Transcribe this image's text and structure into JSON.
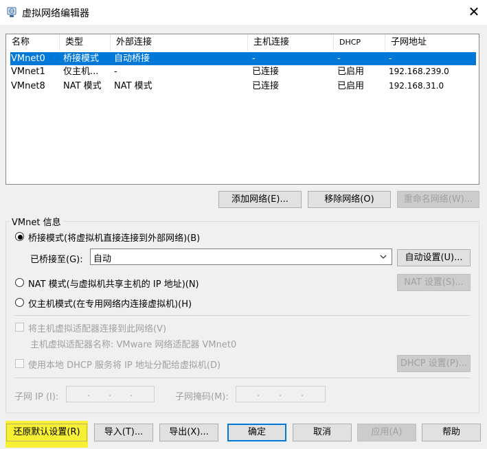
{
  "window": {
    "title": "虚拟网络编辑器",
    "close_label": "✕"
  },
  "table": {
    "columns": [
      "名称",
      "类型",
      "外部连接",
      "主机连接",
      "DHCP",
      "子网地址"
    ],
    "rows": [
      {
        "name": "VMnet0",
        "type": "桥接模式",
        "external": "自动桥接",
        "host": "-",
        "dhcp": "-",
        "subnet": "-"
      },
      {
        "name": "VMnet1",
        "type": "仅主机...",
        "external": "-",
        "host": "已连接",
        "dhcp": "已启用",
        "subnet": "192.168.239.0"
      },
      {
        "name": "VMnet8",
        "type": "NAT 模式",
        "external": "NAT 模式",
        "host": "已连接",
        "dhcp": "已启用",
        "subnet": "192.168.31.0"
      }
    ],
    "selected_row": 0
  },
  "net_buttons": {
    "add": "添加网络(E)...",
    "remove": "移除网络(O)",
    "rename": "重命名网络(W)..."
  },
  "vmnet_info": {
    "group_title": "VMnet 信息",
    "bridge_radio": "桥接模式(将虚拟机直接连接到外部网络)(B)",
    "bridged_to_label": "已桥接至(G):",
    "bridged_to_value": "自动",
    "auto_settings": "自动设置(U)...",
    "nat_radio": "NAT 模式(与虚拟机共享主机的 IP 地址)(N)",
    "nat_settings": "NAT 设置(S)...",
    "hostonly_radio": "仅主机模式(在专用网络内连接虚拟机)(H)",
    "connect_adapter": "将主机虚拟适配器连接到此网络(V)",
    "adapter_name": "主机虚拟适配器名称: VMware 网络适配器 VMnet0",
    "use_dhcp": "使用本地 DHCP 服务将 IP 地址分配给虚拟机(D)",
    "dhcp_settings": "DHCP 设置(P)...",
    "subnet_ip_label": "子网 IP (I):",
    "subnet_mask_label": "子网掩码(M):",
    "ip_dots": ".",
    "selected_mode": "bridge"
  },
  "footer": {
    "restore": "还原默认设置(R)",
    "import": "导入(T)...",
    "export": "导出(X)...",
    "ok": "确定",
    "cancel": "取消",
    "apply": "应用(A)",
    "help": "帮助"
  },
  "colors": {
    "selection": "#0078d7",
    "highlight": "#f7f01f"
  }
}
